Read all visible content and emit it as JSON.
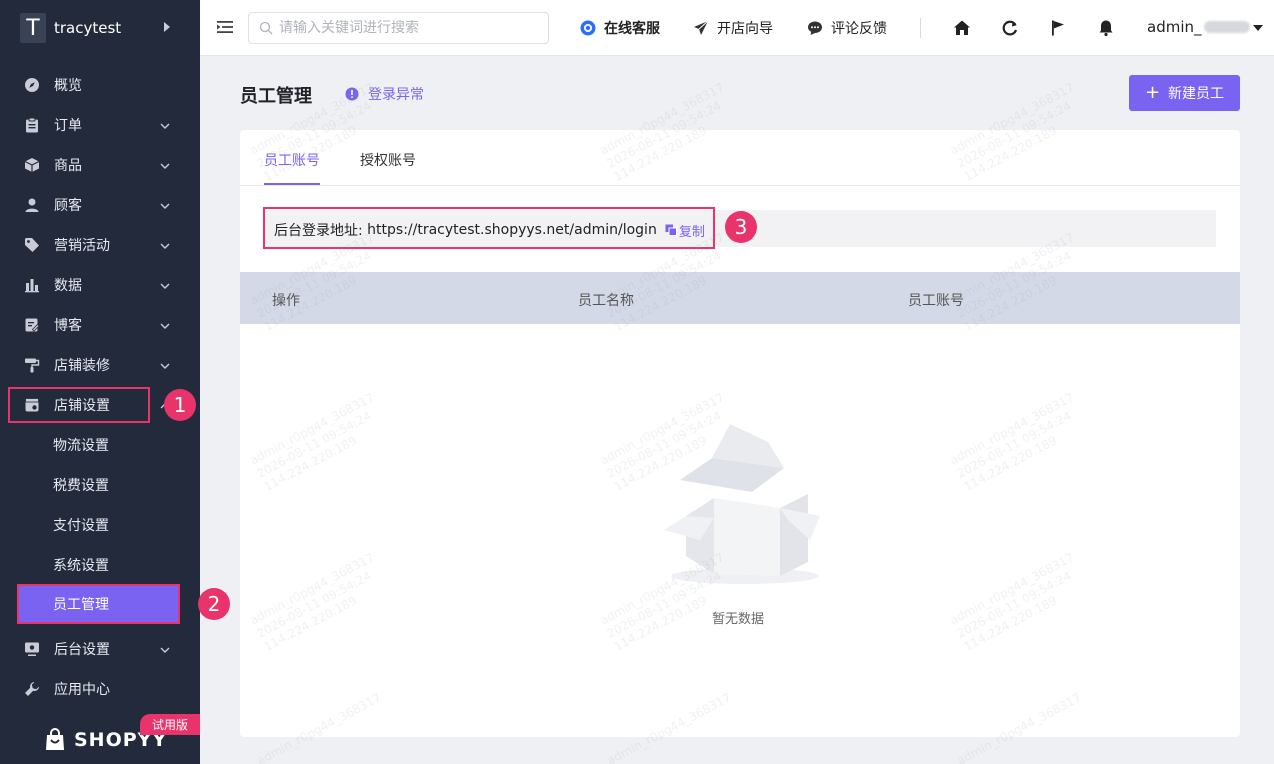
{
  "sidebar": {
    "store": {
      "logo_letter": "T",
      "name": "tracytest"
    },
    "items": [
      {
        "label": "概览",
        "icon": "compass-icon"
      },
      {
        "label": "订单",
        "icon": "clipboard-icon"
      },
      {
        "label": "商品",
        "icon": "box-icon"
      },
      {
        "label": "顾客",
        "icon": "user-icon"
      },
      {
        "label": "营销活动",
        "icon": "tag-icon"
      },
      {
        "label": "数据",
        "icon": "bar-chart-icon"
      },
      {
        "label": "博客",
        "icon": "blog-icon"
      },
      {
        "label": "店铺装修",
        "icon": "paint-roller-icon"
      },
      {
        "label": "店铺设置",
        "icon": "store-settings-icon"
      }
    ],
    "sub_items": [
      {
        "label": "物流设置"
      },
      {
        "label": "税费设置"
      },
      {
        "label": "支付设置"
      },
      {
        "label": "系统设置"
      },
      {
        "label": "员工管理",
        "active": true
      }
    ],
    "items_after": [
      {
        "label": "后台设置",
        "icon": "monitor-gear-icon"
      },
      {
        "label": "应用中心",
        "icon": "wrench-icon"
      }
    ],
    "brand": "SHOPYY",
    "trial_tag": "试用版"
  },
  "annotations": {
    "one": "1",
    "two": "2",
    "three": "3",
    "color": "#e8336b"
  },
  "topbar": {
    "search_placeholder": "请输入关键词进行搜索",
    "links": {
      "service": "在线客服",
      "guide": "开店向导",
      "feedback": "评论反馈"
    },
    "user": "admin_"
  },
  "main": {
    "title": "员工管理",
    "warning": "登录异常",
    "new_button": "新建员工",
    "tabs": [
      "员工账号",
      "授权账号"
    ],
    "login_label": "后台登录地址:",
    "login_url": "https://tracytest.shopyys.net/admin/login",
    "copy_label": "复制",
    "table_headers": [
      "操作",
      "员工名称",
      "员工账号"
    ],
    "empty_text": "暂无数据"
  },
  "watermark": {
    "line1": "admin_r0pg44_368317",
    "line2": "2026-08-11 09:54:24",
    "line3": "114.224.220.189"
  },
  "colors": {
    "accent": "#7a63f0",
    "sidebar_bg": "#222a3b",
    "highlight": "#e8336b"
  }
}
